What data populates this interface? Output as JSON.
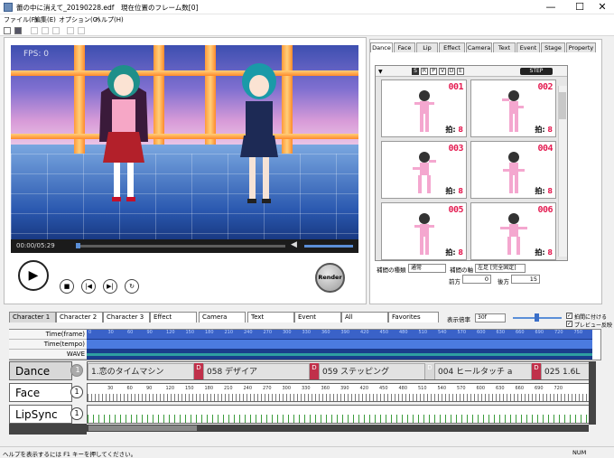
{
  "titlebar": {
    "file": "蕾の中に消えて_20190228.edf",
    "frame_info": "現在位置のフレーム数[0]",
    "minimize": "—",
    "maximize": "☐",
    "close": "✕"
  },
  "menu": [
    "ファイル(F)",
    "編集(E)",
    "オプション(O)",
    "ヘルプ(H)"
  ],
  "video": {
    "fps": "FPS: 0",
    "timecode": "00:00/05:29",
    "seek_progress": 0.0,
    "volume_level": 1.0,
    "render_label": "Render"
  },
  "right_tabs": [
    "Dance",
    "Face",
    "Lip",
    "Effect",
    "Camera",
    "Text",
    "Event",
    "Stage",
    "Property"
  ],
  "filters": [
    "S",
    "R",
    "P",
    "V",
    "D",
    "E"
  ],
  "step_label": "STEP",
  "motions": [
    {
      "num": "001",
      "beat_label": "拍:",
      "beat": "8"
    },
    {
      "num": "002",
      "beat_label": "拍:",
      "beat": "8"
    },
    {
      "num": "003",
      "beat_label": "拍:",
      "beat": "8"
    },
    {
      "num": "004",
      "beat_label": "拍:",
      "beat": "8"
    },
    {
      "num": "005",
      "beat_label": "拍:",
      "beat": "8"
    },
    {
      "num": "006",
      "beat_label": "拍:",
      "beat": "8"
    }
  ],
  "interp": {
    "type_label": "補間の種類",
    "type_value": "通常",
    "axis_label": "補間の軸",
    "axis_value": "左足 [完全固定]",
    "front_label": "前方",
    "front_value": "0",
    "back_label": "後方",
    "back_value": "15"
  },
  "bottom_tabs": [
    "Character 1",
    "Character 2",
    "Character 3",
    "Effect",
    "Camera",
    "Text",
    "Event",
    "All",
    "Favorites"
  ],
  "display_scale": {
    "label": "表示倍率",
    "value": "30f"
  },
  "options": {
    "snap": "拍間に付ける",
    "preview": "プレビュー反映"
  },
  "ruler": {
    "rows": [
      "Time(frame)",
      "Time(tempo)",
      "WAVE"
    ],
    "frame_ticks": [
      "0",
      "30",
      "60",
      "90",
      "120",
      "150",
      "180",
      "210",
      "240",
      "270",
      "300",
      "330",
      "360",
      "390",
      "420",
      "450",
      "480",
      "510",
      "540",
      "570",
      "600",
      "630",
      "660",
      "690",
      "720",
      "750"
    ]
  },
  "tracks": [
    {
      "name": "Dance",
      "num": "1"
    },
    {
      "name": "Face",
      "num": "1"
    },
    {
      "name": "LipSync",
      "num": "1"
    }
  ],
  "dance_clips": [
    "1.恋のタイムマシン",
    "058 デザイア",
    "059 ステッピング",
    "004 ヒールタッチ a",
    "025 1.6L"
  ],
  "clip_flag": "D",
  "face_ticks": [
    "30",
    "60",
    "90",
    "120",
    "150",
    "180",
    "210",
    "240",
    "270",
    "300",
    "330",
    "360",
    "390",
    "420",
    "450",
    "480",
    "510",
    "540",
    "570",
    "600",
    "630",
    "660",
    "690",
    "720"
  ],
  "status": {
    "help": "ヘルプを表示するには F1 キーを押してください。",
    "num": "NUM"
  }
}
